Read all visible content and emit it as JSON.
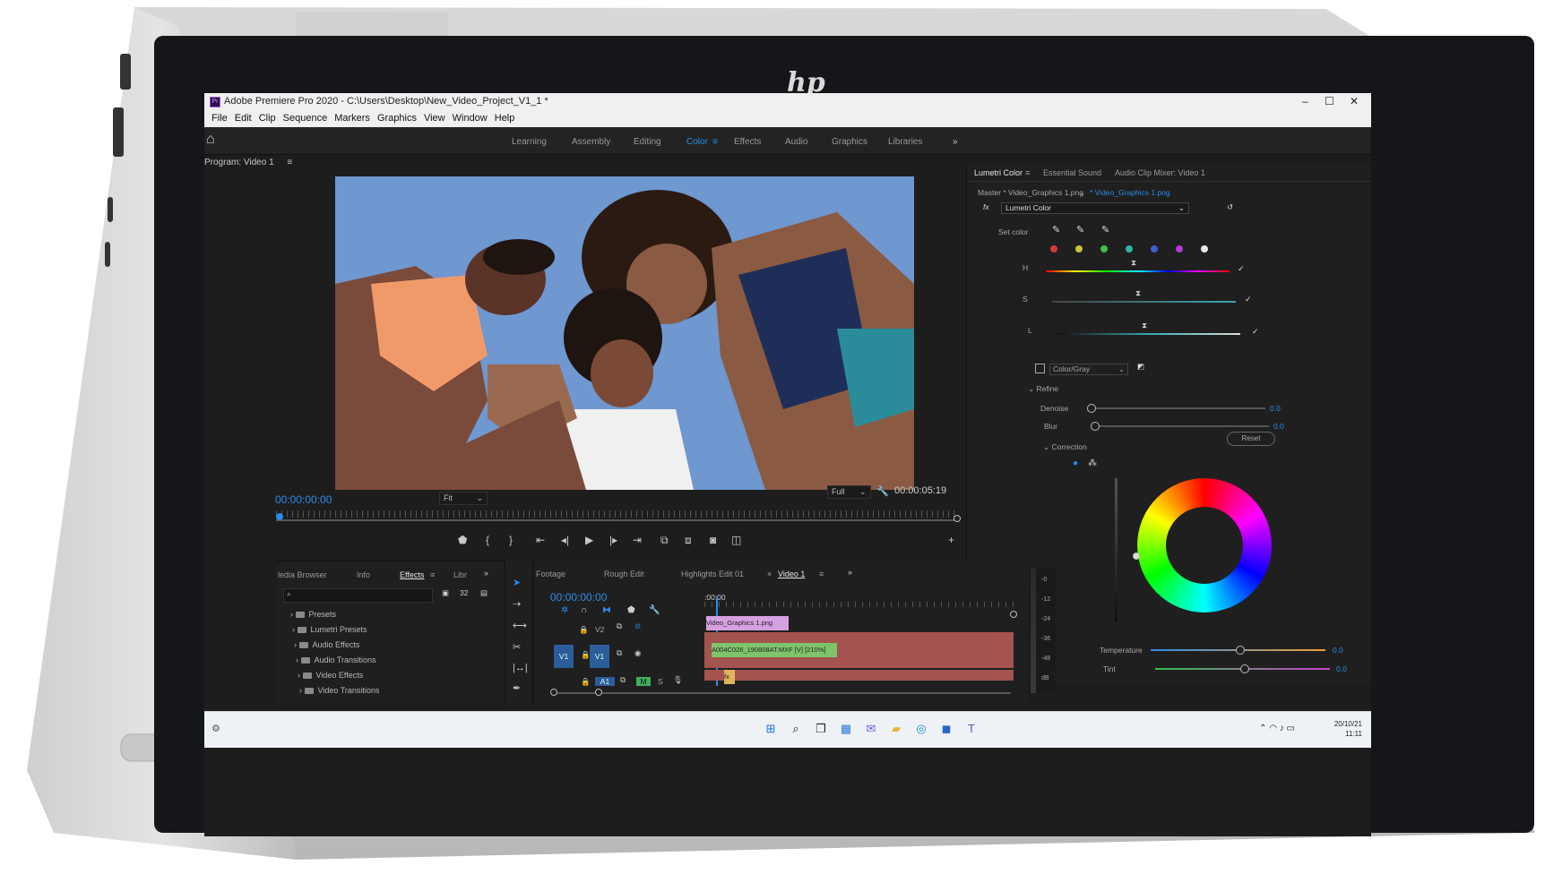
{
  "window": {
    "title": "Adobe Premiere Pro 2020 - C:\\Users\\Desktop\\New_Video_Project_V1_1 *",
    "icon_text": "Pr",
    "controls": [
      "–",
      "☐",
      "✕"
    ]
  },
  "menu": [
    "File",
    "Edit",
    "Clip",
    "Sequence",
    "Markers",
    "Graphics",
    "View",
    "Window",
    "Help"
  ],
  "workspaces": [
    "Learning",
    "Assembly",
    "Editing",
    "Color",
    "Effects",
    "Audio",
    "Graphics",
    "Libraries"
  ],
  "active_workspace": "Color",
  "program_monitor": {
    "label": "Program: Video 1",
    "timecode_in": "00:00:00:00",
    "fit": "Fit",
    "quality": "Full",
    "timecode_out": "00:00:05:19"
  },
  "lumetri": {
    "tabs": [
      "Lumetri Color",
      "Essential Sound",
      "Audio Clip Mixer: Video 1"
    ],
    "master": "Master * Video_Graphics 1.png",
    "clip": "* Video_Graphics 1.png",
    "effect": "Lumetri Color",
    "fx": "fx",
    "set_color": "Set color",
    "hsl": [
      "H",
      "S",
      "L"
    ],
    "color_gray": "Color/Gray",
    "reset": "Reset",
    "refine": "Refine",
    "denoise": {
      "label": "Denoise",
      "value": "0.0"
    },
    "blur": {
      "label": "Blur",
      "value": "0.0"
    },
    "correction": "Correction",
    "temperature": {
      "label": "Temperature",
      "value": "0.0"
    },
    "tint": {
      "label": "Tint",
      "value": "0.0"
    },
    "swatch_colors": [
      "#d43a3a",
      "#c9c43a",
      "#3fbf4a",
      "#31b3a6",
      "#3a5fd6",
      "#b13ad4",
      "#e8e8e8"
    ]
  },
  "effects_panel": {
    "tabs": [
      "ledia Browser",
      "Info",
      "Effects",
      "Libr"
    ],
    "items": [
      "Presets",
      "Lumetri Presets",
      "Audio Effects",
      "Audio Transitions",
      "Video Effects",
      "Video Transitions"
    ]
  },
  "timeline": {
    "tabs": [
      "Footage",
      "Rough Edit",
      "Highlights Edit 01",
      "Video 1"
    ],
    "timecode": "00:00:00:00",
    "ruler_start": ":00:00",
    "tracks": [
      "V2",
      "V1",
      "V1",
      "A1",
      "M",
      "S"
    ],
    "clips": [
      {
        "label": "Video_Graphics 1.png",
        "color": "#d7a0e0"
      },
      {
        "label": "A004C026_190808AT.MXF [V] [210%]",
        "color": "#7fc46b"
      },
      {
        "label": "fx",
        "color": "#e0b25a"
      }
    ],
    "meter_labels": [
      "-0",
      "-12",
      "-24",
      "-36",
      "-48",
      "dB"
    ]
  },
  "taskbar": {
    "date": "20/10/21",
    "time": "11:11",
    "icons": [
      "start-icon",
      "search-icon",
      "task-view-icon",
      "widgets-icon",
      "chat-icon",
      "file-explorer-icon",
      "edge-icon",
      "store-icon",
      "teams-icon"
    ]
  },
  "brand": "hp"
}
